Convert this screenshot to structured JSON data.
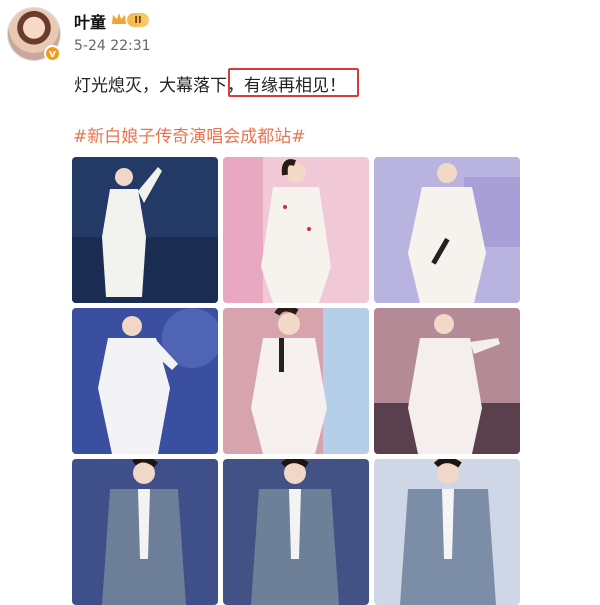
{
  "post": {
    "username": "叶童",
    "level_badge": "II",
    "verified_mark": "v",
    "timestamp": "5-24 22:31",
    "text_main": "灯光熄灭，大幕落下，",
    "text_highlight": "有缘再相见！",
    "hashtag": "#新白娘子传奇演唱会成都站#"
  },
  "icons": {
    "crown": "crown-icon",
    "verified": "verified-badge-icon"
  },
  "colors": {
    "hashtag": "#eb7350",
    "highlight_border": "#d93a3a",
    "badge": "#f39b1a"
  },
  "photos": [
    {
      "id": "photo-1",
      "bg": "#233a66",
      "outfit": "#f2f2ee",
      "scene": "dark-blue-stage"
    },
    {
      "id": "photo-2",
      "bg": "#f0c8d6",
      "outfit": "#f6f2ee",
      "scene": "pink-stage"
    },
    {
      "id": "photo-3",
      "bg": "#b9b3e0",
      "outfit": "#f6f3ef",
      "scene": "lavender-stage"
    },
    {
      "id": "photo-4",
      "bg": "#3b4fa0",
      "outfit": "#f3f3f6",
      "scene": "blue-light-stage"
    },
    {
      "id": "photo-5",
      "bg": "#d7a3ad",
      "outfit": "#f6f1ee",
      "scene": "rose-stage"
    },
    {
      "id": "photo-6",
      "bg": "#b48a96",
      "outfit": "#f4efec",
      "scene": "mauve-stage"
    },
    {
      "id": "photo-7",
      "bg": "#3e4f8a",
      "outfit": "#6c7e98",
      "scene": "blue-suit"
    },
    {
      "id": "photo-8",
      "bg": "#425284",
      "outfit": "#6e7f98",
      "scene": "blue-suit"
    },
    {
      "id": "photo-9",
      "bg": "#cfd7e6",
      "outfit": "#7c8ea7",
      "scene": "blue-suit-light"
    }
  ]
}
